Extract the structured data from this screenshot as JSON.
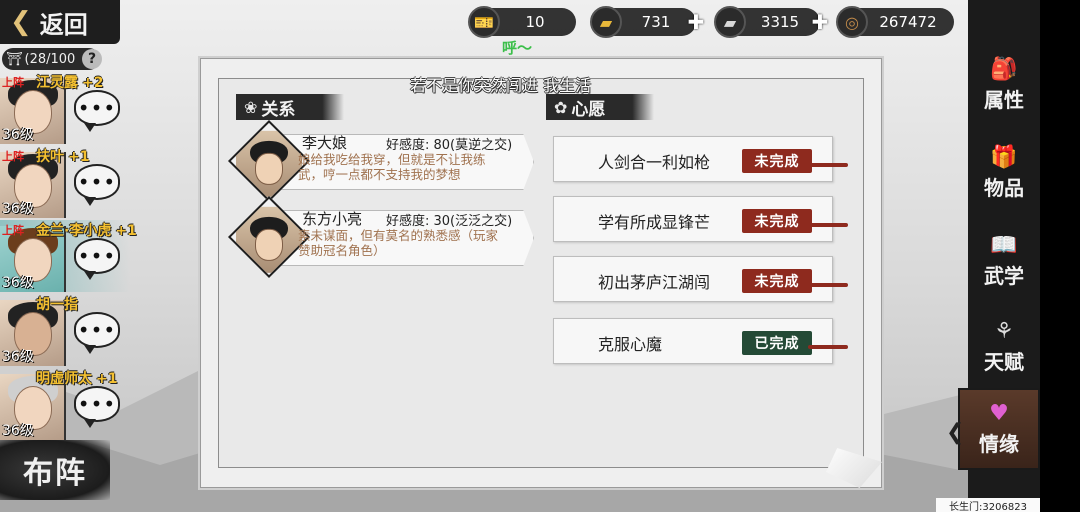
{
  "header": {
    "back_label": "返回",
    "capacity": "(28/100"
  },
  "currencies": [
    {
      "icon": "ticket-icon",
      "value": "10"
    },
    {
      "icon": "gold-ingot-icon",
      "value": "731"
    },
    {
      "icon": "silver-ingot-icon",
      "value": "3315"
    },
    {
      "icon": "copper-coin-icon",
      "value": "267472"
    }
  ],
  "float_text": "呼〜",
  "dialog_line": "若不是你突然闯进 我生活",
  "companions": [
    {
      "tag": "上阵",
      "name": "江灵露",
      "bonus": "+2",
      "level": "36级"
    },
    {
      "tag": "上阵",
      "name": "扶叶",
      "bonus": "+1",
      "level": "36级"
    },
    {
      "tag": "上阵",
      "name": "金兰·李小虎",
      "bonus": "+1",
      "level": "36级"
    },
    {
      "tag": "",
      "name": "胡一指",
      "bonus": "",
      "level": "36级"
    },
    {
      "tag": "",
      "name": "明虚师太",
      "bonus": "+1",
      "level": "36级"
    }
  ],
  "chat_glyph": "•••",
  "formation_label": "布阵",
  "relations_section": {
    "title": "关系",
    "items": [
      {
        "name": "李大娘",
        "favor": "好感度:  80(莫逆之交)",
        "desc": "娘给我吃给我穿，但就是不让我练武，哼一点都不支持我的梦想"
      },
      {
        "name": "东方小亮",
        "favor": "好感度:  30(泛泛之交)",
        "desc": "素未谋面，但有莫名的熟悉感（玩家赞助冠名角色）"
      }
    ]
  },
  "wishes_section": {
    "title": "心愿",
    "items": [
      {
        "text": "人剑合一利如枪",
        "status": "未完成",
        "done": false
      },
      {
        "text": "学有所成显锋芒",
        "status": "未完成",
        "done": false
      },
      {
        "text": "初出茅庐江湖闯",
        "status": "未完成",
        "done": false
      },
      {
        "text": "克服心魔",
        "status": "已完成",
        "done": true
      }
    ]
  },
  "right_menu": [
    {
      "label": "属性",
      "icon": "bag-icon"
    },
    {
      "label": "物品",
      "icon": "gift-box-icon"
    },
    {
      "label": "武学",
      "icon": "book-icon"
    },
    {
      "label": "天赋",
      "icon": "branch-icon"
    },
    {
      "label": "情缘",
      "icon": "heart-icon",
      "active": true
    }
  ],
  "sect_id": "长生门:3206823",
  "colors": {
    "incomplete": "#8e2a1e",
    "complete": "#244a36",
    "name_gold": "#f4c030",
    "onfield_red": "#d22222"
  }
}
